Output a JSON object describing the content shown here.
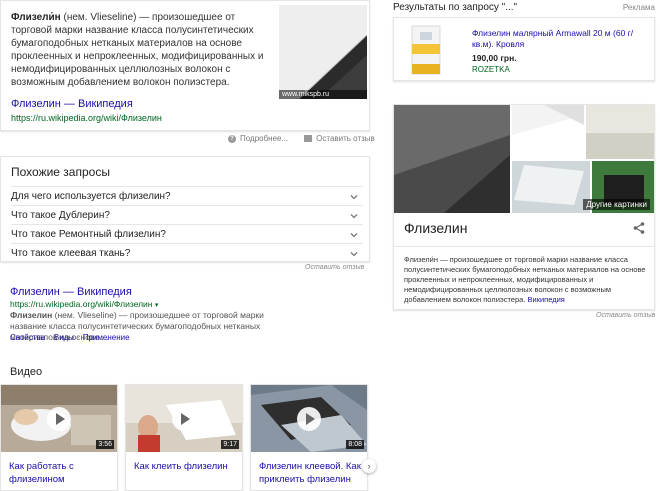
{
  "snippet": {
    "term": "Флизели́н",
    "body": " (нем. Vlieseline) — произошедшее от торговой марки название класса полусинтетических бумагоподобных нетканых материалов на основе проклеенных и непроклеенных, модифицированных и немодифицированных целлюлозных волокон с возможным добавлением волокон полиэстера.",
    "image_credit": "www.mikspb.ru",
    "link_title": "Флизелин — Википедия",
    "link_url": "https://ru.wikipedia.org/wiki/Флизелин",
    "about_label": "Подробнее...",
    "feedback_label": "Оставить отзыв"
  },
  "related": {
    "title": "Похожие запросы",
    "questions": [
      "Для чего используется флизелин?",
      "Что такое Дублерин?",
      "Что такое Ремонтный флизелин?",
      "Что такое клеевая ткань?"
    ],
    "feedback_label": "Оставить отзыв"
  },
  "organic": {
    "title": "Флизелин — Википедия",
    "url": "https://ru.wikipedia.org/wiki/Флизелин",
    "url_arrow": "▾",
    "desc_term": "Флизелин",
    "desc": " (нем. Vlieseline) — произошедшее от торговой марки название класса полусинтетических бумагоподобных нетканых материалов на основе ...",
    "sitelinks": [
      "Свойства",
      "Виды",
      "Применение"
    ]
  },
  "videos": {
    "heading": "Видео",
    "items": [
      {
        "title": "Как работать с флизелином",
        "duration": "3:56"
      },
      {
        "title": "Как клеить флизелин",
        "duration": "9:17"
      },
      {
        "title": "Флизелин клеевой. Как приклеить флизелин",
        "duration": "8:08"
      }
    ],
    "next_glyph": "›"
  },
  "ads": {
    "header": "Результаты по запросу \"...\"",
    "label": "Реклама",
    "item": {
      "title": "Флизелин малярный Armawall 20 м (60 г/кв.м). Кровля",
      "price": "190,00 грн.",
      "seller": "ROZETKA"
    }
  },
  "knowledge_panel": {
    "title": "Флизелин",
    "more_images": "Другие картинки",
    "desc": "Флизели́н — произошедшее от торговой марки название класса полусинтетических бумагоподобных нетканых материалов на основе проклеенных и непроклеенных, модифицированных и немодифицированных целлюлозных волокон с возможным добавлением волокон полиэстера.",
    "source_link": "Википедия",
    "feedback_label": "Оставить отзыв"
  },
  "colors": {
    "link": "#1a0dab",
    "url_green": "#006621",
    "text": "#222222",
    "muted": "#777777"
  }
}
